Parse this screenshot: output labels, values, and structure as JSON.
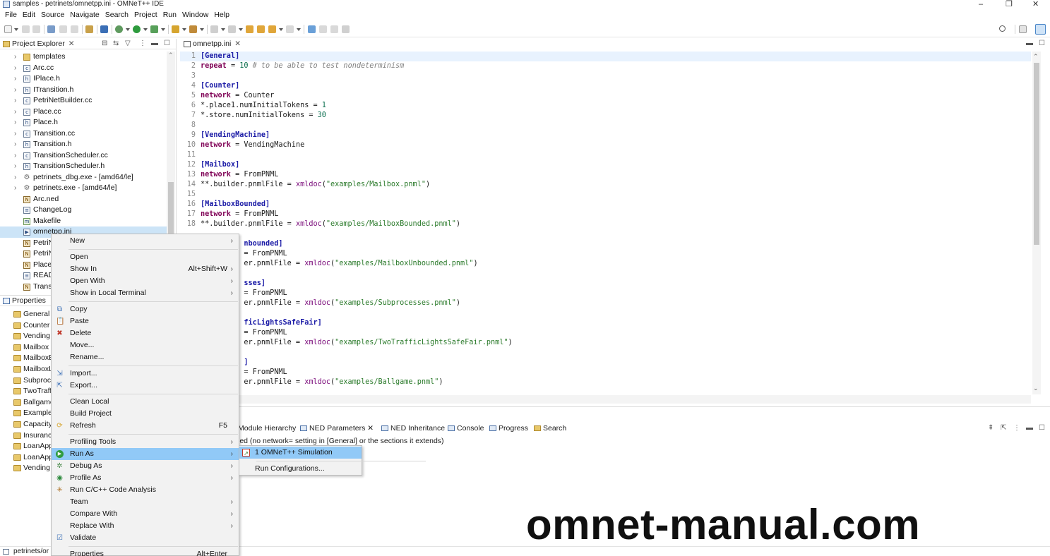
{
  "window": {
    "title": "samples - petrinets/omnetpp.ini - OMNeT++ IDE",
    "controls": [
      "–",
      "❐",
      "✕"
    ]
  },
  "menubar": [
    "File",
    "Edit",
    "Source",
    "Navigate",
    "Search",
    "Project",
    "Run",
    "Window",
    "Help"
  ],
  "explorer": {
    "tab_label": "Project Explorer",
    "items": [
      {
        "label": "templates",
        "kind": "folder",
        "expand": true
      },
      {
        "label": "Arc.cc",
        "kind": "c",
        "expand": true
      },
      {
        "label": "IPlace.h",
        "kind": "h",
        "expand": true
      },
      {
        "label": "ITransition.h",
        "kind": "h",
        "expand": true
      },
      {
        "label": "PetriNetBuilder.cc",
        "kind": "c",
        "expand": true
      },
      {
        "label": "Place.cc",
        "kind": "c",
        "expand": true
      },
      {
        "label": "Place.h",
        "kind": "h",
        "expand": true
      },
      {
        "label": "Transition.cc",
        "kind": "c",
        "expand": true
      },
      {
        "label": "Transition.h",
        "kind": "h",
        "expand": true
      },
      {
        "label": "TransitionScheduler.cc",
        "kind": "c",
        "expand": true
      },
      {
        "label": "TransitionScheduler.h",
        "kind": "h",
        "expand": true
      },
      {
        "label": "petrinets_dbg.exe - [amd64/le]",
        "kind": "exe",
        "expand": true
      },
      {
        "label": "petrinets.exe - [amd64/le]",
        "kind": "exe",
        "expand": true
      },
      {
        "label": "Arc.ned",
        "kind": "ned",
        "expand": false
      },
      {
        "label": "ChangeLog",
        "kind": "txt",
        "expand": false
      },
      {
        "label": "Makefile",
        "kind": "mk",
        "expand": false
      },
      {
        "label": "omnetpp.ini",
        "kind": "ini",
        "expand": false,
        "selected": true
      },
      {
        "label": "PetriN",
        "kind": "ned",
        "expand": false
      },
      {
        "label": "PetriN",
        "kind": "ned",
        "expand": false
      },
      {
        "label": "Place.",
        "kind": "ned",
        "expand": false
      },
      {
        "label": "READ",
        "kind": "txt",
        "expand": false
      },
      {
        "label": "Trans",
        "kind": "ned",
        "expand": false
      }
    ]
  },
  "properties": {
    "tab_label": "Properties",
    "items": [
      "General",
      "Counter",
      "Vending",
      "Mailbox",
      "MailboxE",
      "MailboxL",
      "Subproc",
      "TwoTraff",
      "Ballgame",
      "Example",
      "Capacity",
      "Insuranc",
      "LoanApp",
      "LoanApp",
      "Vending"
    ]
  },
  "editor": {
    "tab_label": "omnetpp.ini",
    "lines": [
      {
        "n": "1",
        "parts": [
          {
            "t": "[General]",
            "c": "sec"
          }
        ],
        "current": true
      },
      {
        "n": "2",
        "parts": [
          {
            "t": "repeat",
            "c": "key"
          },
          {
            "t": " = ",
            "c": ""
          },
          {
            "t": "10",
            "c": "num"
          },
          {
            "t": " # to be able to test nondeterminism",
            "c": "cmt"
          }
        ]
      },
      {
        "n": "3",
        "parts": []
      },
      {
        "n": "4",
        "parts": [
          {
            "t": "[Counter]",
            "c": "sec"
          }
        ]
      },
      {
        "n": "5",
        "parts": [
          {
            "t": "network",
            "c": "key"
          },
          {
            "t": " = Counter",
            "c": ""
          }
        ]
      },
      {
        "n": "6",
        "parts": [
          {
            "t": "*.place1.numInitialTokens = ",
            "c": ""
          },
          {
            "t": "1",
            "c": "num"
          }
        ]
      },
      {
        "n": "7",
        "parts": [
          {
            "t": "*.store.numInitialTokens = ",
            "c": ""
          },
          {
            "t": "30",
            "c": "num"
          }
        ]
      },
      {
        "n": "8",
        "parts": []
      },
      {
        "n": "9",
        "parts": [
          {
            "t": "[VendingMachine]",
            "c": "sec"
          }
        ]
      },
      {
        "n": "10",
        "parts": [
          {
            "t": "network",
            "c": "key"
          },
          {
            "t": " = VendingMachine",
            "c": ""
          }
        ]
      },
      {
        "n": "11",
        "parts": []
      },
      {
        "n": "12",
        "parts": [
          {
            "t": "[Mailbox]",
            "c": "sec"
          }
        ]
      },
      {
        "n": "13",
        "parts": [
          {
            "t": "network",
            "c": "key"
          },
          {
            "t": " = FromPNML",
            "c": ""
          }
        ]
      },
      {
        "n": "14",
        "parts": [
          {
            "t": "**.builder.pnmlFile = ",
            "c": ""
          },
          {
            "t": "xmldoc",
            "c": "fn"
          },
          {
            "t": "(",
            "c": ""
          },
          {
            "t": "\"examples/Mailbox.pnml\"",
            "c": "str"
          },
          {
            "t": ")",
            "c": ""
          }
        ]
      },
      {
        "n": "15",
        "parts": []
      },
      {
        "n": "16",
        "parts": [
          {
            "t": "[MailboxBounded]",
            "c": "sec"
          }
        ]
      },
      {
        "n": "17",
        "parts": [
          {
            "t": "network",
            "c": "key"
          },
          {
            "t": " = FromPNML",
            "c": ""
          }
        ]
      },
      {
        "n": "18",
        "parts": [
          {
            "t": "**.builder.pnmlFile = ",
            "c": ""
          },
          {
            "t": "xmldoc",
            "c": "fn"
          },
          {
            "t": "(",
            "c": ""
          },
          {
            "t": "\"examples/MailboxBounded.pnml\"",
            "c": "str"
          },
          {
            "t": ")",
            "c": ""
          }
        ]
      },
      {
        "n": "",
        "parts": []
      },
      {
        "n": "",
        "parts": [
          {
            "t": "          nbounded]",
            "c": "sec"
          }
        ]
      },
      {
        "n": "",
        "parts": [
          {
            "t": "          = FromPNML",
            "c": ""
          }
        ]
      },
      {
        "n": "",
        "parts": [
          {
            "t": "          er.pnmlFile = ",
            "c": ""
          },
          {
            "t": "xmldoc",
            "c": "fn"
          },
          {
            "t": "(",
            "c": ""
          },
          {
            "t": "\"examples/MailboxUnbounded.pnml\"",
            "c": "str"
          },
          {
            "t": ")",
            "c": ""
          }
        ]
      },
      {
        "n": "",
        "parts": []
      },
      {
        "n": "",
        "parts": [
          {
            "t": "          sses]",
            "c": "sec"
          }
        ]
      },
      {
        "n": "",
        "parts": [
          {
            "t": "          = FromPNML",
            "c": ""
          }
        ]
      },
      {
        "n": "",
        "parts": [
          {
            "t": "          er.pnmlFile = ",
            "c": ""
          },
          {
            "t": "xmldoc",
            "c": "fn"
          },
          {
            "t": "(",
            "c": ""
          },
          {
            "t": "\"examples/Subprocesses.pnml\"",
            "c": "str"
          },
          {
            "t": ")",
            "c": ""
          }
        ]
      },
      {
        "n": "",
        "parts": []
      },
      {
        "n": "",
        "parts": [
          {
            "t": "          ficLightsSafeFair]",
            "c": "sec"
          }
        ]
      },
      {
        "n": "",
        "parts": [
          {
            "t": "          = FromPNML",
            "c": ""
          }
        ]
      },
      {
        "n": "",
        "parts": [
          {
            "t": "          er.pnmlFile = ",
            "c": ""
          },
          {
            "t": "xmldoc",
            "c": "fn"
          },
          {
            "t": "(",
            "c": ""
          },
          {
            "t": "\"examples/TwoTrafficLightsSafeFair.pnml\"",
            "c": "str"
          },
          {
            "t": ")",
            "c": ""
          }
        ]
      },
      {
        "n": "",
        "parts": []
      },
      {
        "n": "",
        "parts": [
          {
            "t": "          ]",
            "c": "sec"
          }
        ]
      },
      {
        "n": "",
        "parts": [
          {
            "t": "          = FromPNML",
            "c": ""
          }
        ]
      },
      {
        "n": "",
        "parts": [
          {
            "t": "          er.pnmlFile = ",
            "c": ""
          },
          {
            "t": "xmldoc",
            "c": "fn"
          },
          {
            "t": "(",
            "c": ""
          },
          {
            "t": "\"examples/Ballgame.pnml\"",
            "c": "str"
          },
          {
            "t": ")",
            "c": ""
          }
        ]
      }
    ]
  },
  "bottom": {
    "tabs": [
      "Module Hierarchy",
      "NED Parameters",
      "NED Inheritance",
      "Console",
      "Progress",
      "Search"
    ],
    "message": "ied (no network= setting in [General] or the sections it extends)"
  },
  "statusbar": {
    "text": "petrinets/or"
  },
  "context_menu": {
    "items": [
      {
        "label": "New",
        "sub": true
      },
      {
        "sep": true
      },
      {
        "label": "Open"
      },
      {
        "label": "Show In",
        "shortcut": "Alt+Shift+W",
        "sub": true
      },
      {
        "label": "Open With",
        "sub": true
      },
      {
        "label": "Show in Local Terminal",
        "sub": true
      },
      {
        "sep": true
      },
      {
        "label": "Copy",
        "icon": "copy-icon"
      },
      {
        "label": "Paste",
        "icon": "paste-icon"
      },
      {
        "label": "Delete",
        "icon": "delete-icon"
      },
      {
        "label": "Move..."
      },
      {
        "label": "Rename..."
      },
      {
        "sep": true
      },
      {
        "label": "Import...",
        "icon": "import-icon"
      },
      {
        "label": "Export...",
        "icon": "export-icon"
      },
      {
        "sep": true
      },
      {
        "label": "Clean Local"
      },
      {
        "label": "Build Project"
      },
      {
        "label": "Refresh",
        "shortcut": "F5",
        "icon": "refresh-icon"
      },
      {
        "sep": true
      },
      {
        "label": "Profiling Tools",
        "sub": true
      },
      {
        "label": "Run As",
        "sub": true,
        "icon": "run-icon",
        "highlighted": true
      },
      {
        "label": "Debug As",
        "sub": true,
        "icon": "debug-icon"
      },
      {
        "label": "Profile As",
        "sub": true,
        "icon": "profile-icon"
      },
      {
        "label": "Run C/C++ Code Analysis",
        "icon": "analysis-icon"
      },
      {
        "label": "Team",
        "sub": true
      },
      {
        "label": "Compare With",
        "sub": true
      },
      {
        "label": "Replace With",
        "sub": true
      },
      {
        "label": "Validate",
        "icon": "check-icon"
      },
      {
        "sep": true
      },
      {
        "label": "Properties",
        "shortcut": "Alt+Enter"
      }
    ]
  },
  "submenu": {
    "items": [
      {
        "label": "1 OMNeT++ Simulation",
        "highlighted": true
      },
      {
        "sep": true
      },
      {
        "label": "Run Configurations..."
      }
    ]
  },
  "watermark": "omnet-manual.com",
  "colors": {
    "accent": "#0b6fd6",
    "selection": "#cce4f7",
    "menu_highlight": "#91c9f7",
    "current_line": "#e8f2fe",
    "section_color": "#1a1aa6",
    "key_color": "#7f0055",
    "string_color": "#2a7a2a"
  }
}
